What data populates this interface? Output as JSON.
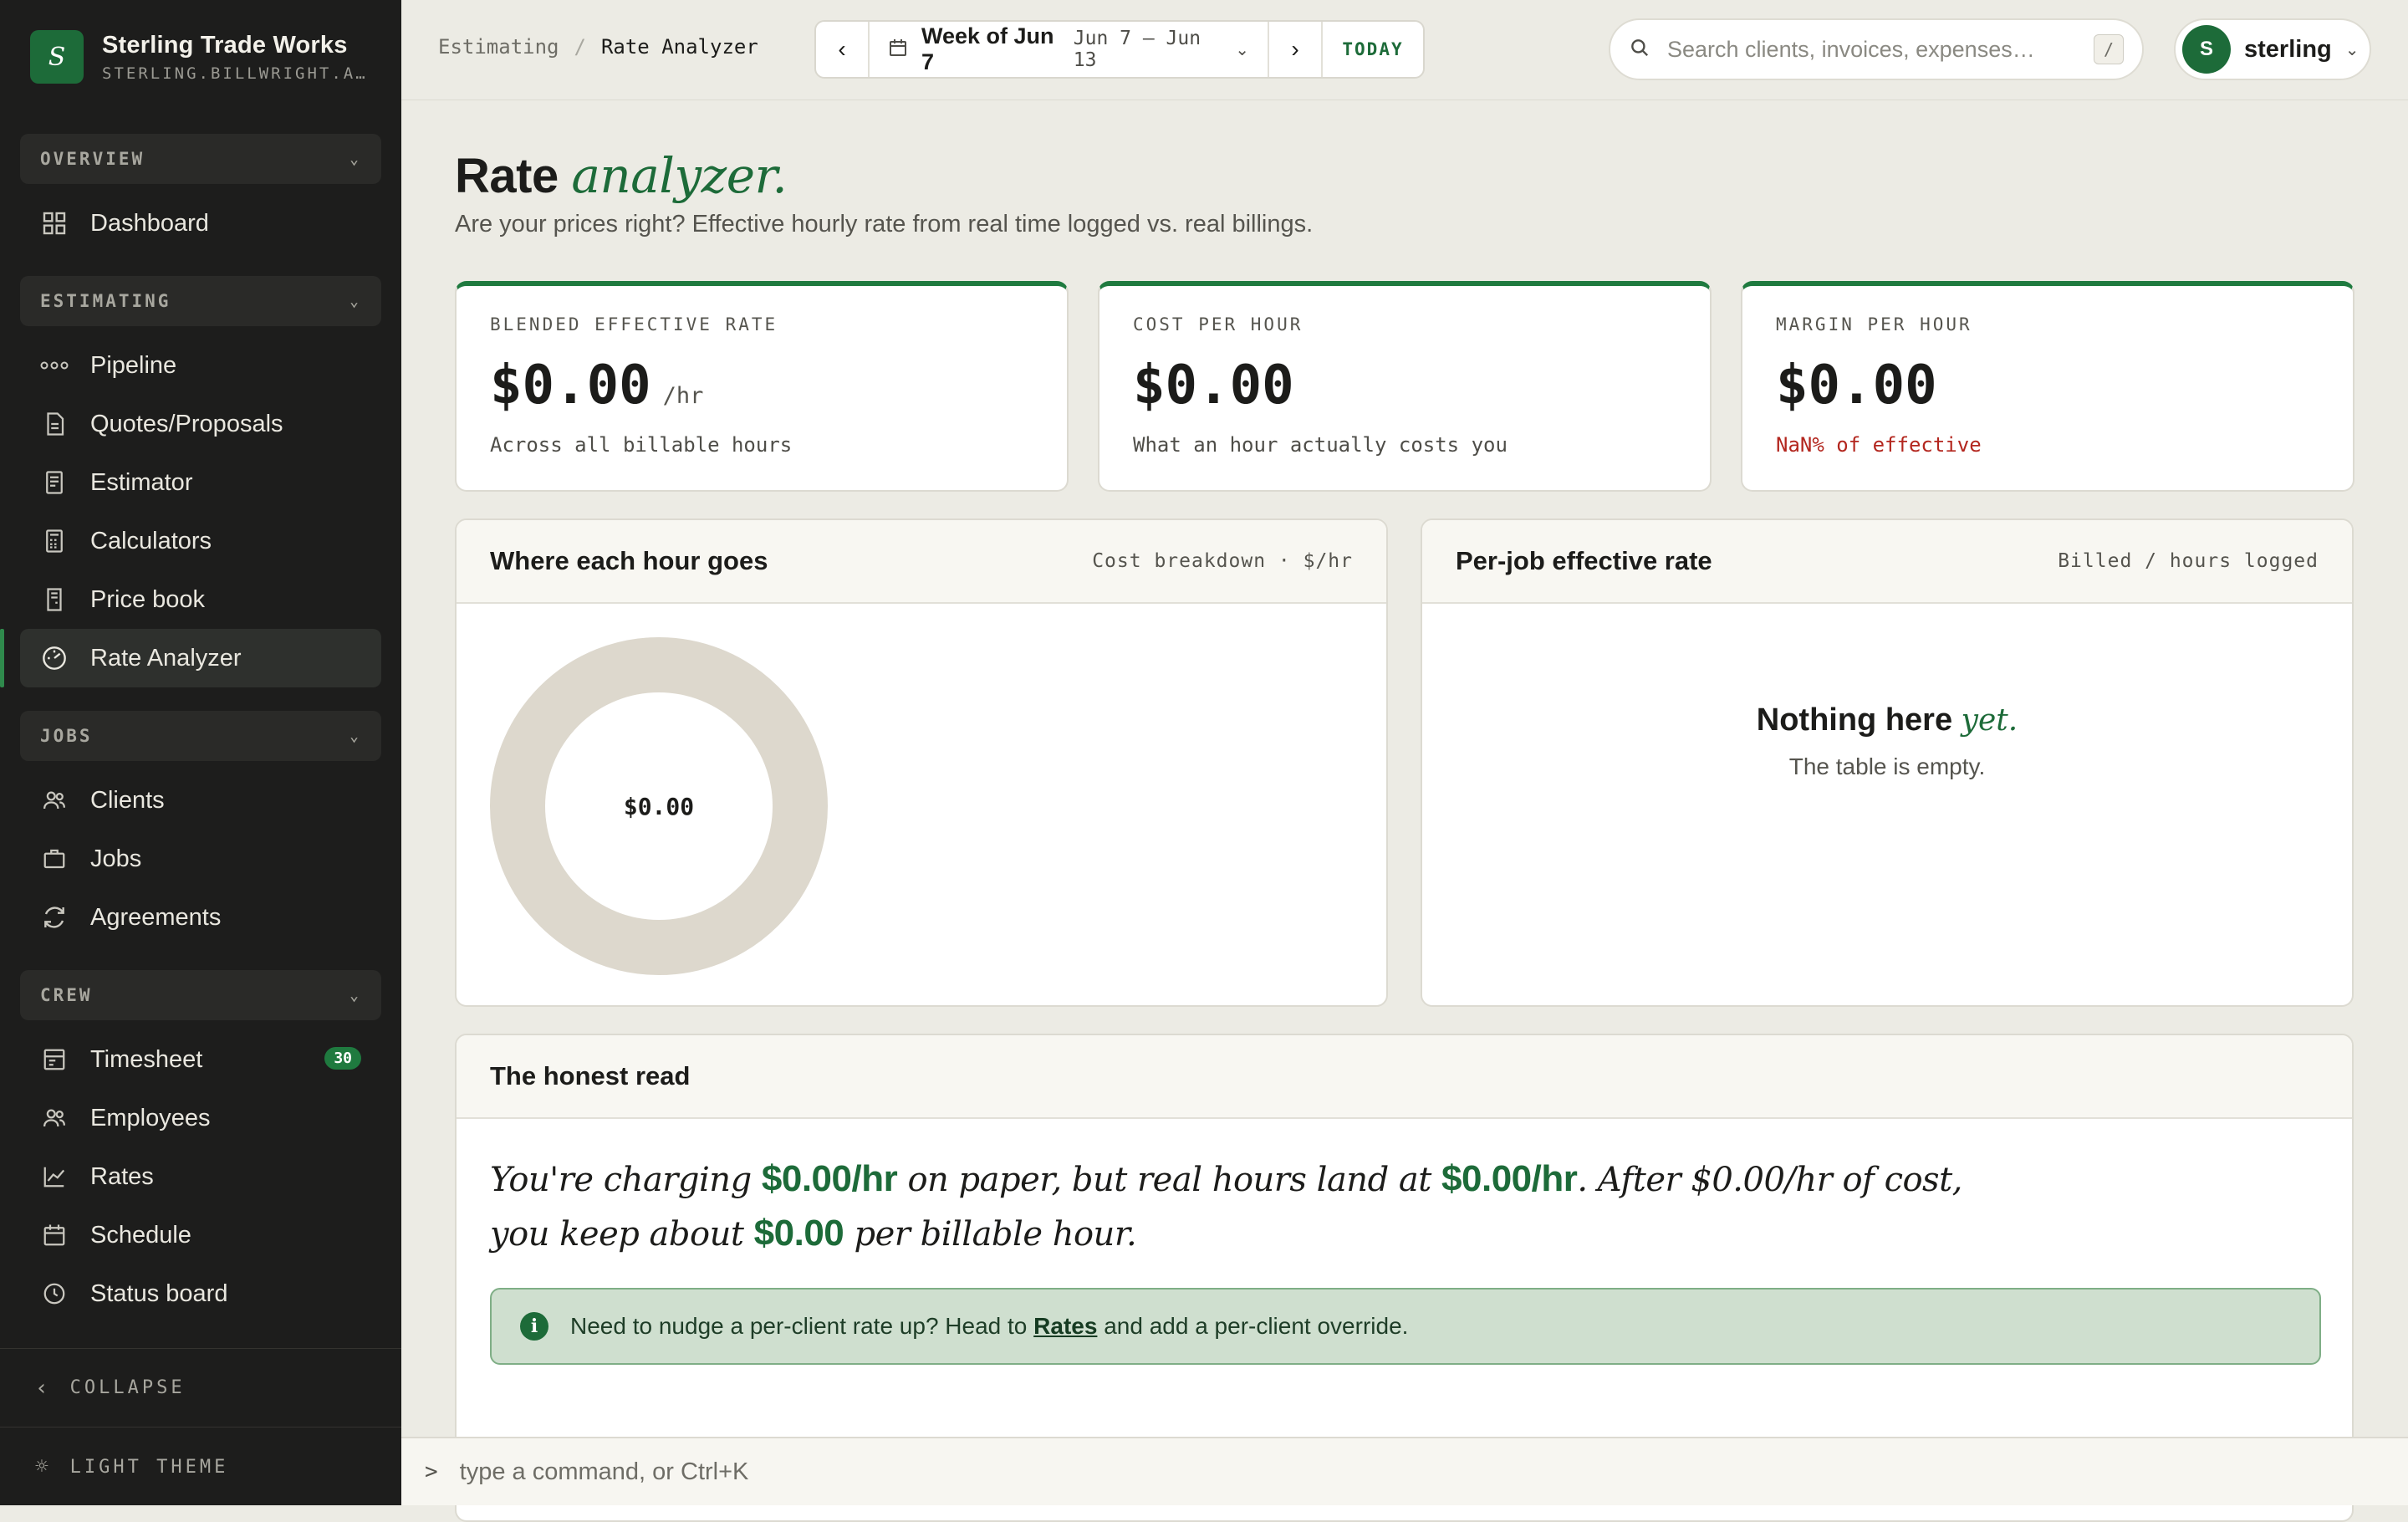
{
  "brand": {
    "name": "Sterling Trade Works",
    "domain": "STERLING.BILLWRIGHT.A…",
    "logo_letter": "S"
  },
  "sidebar": {
    "sections": [
      {
        "label": "OVERVIEW",
        "items": [
          {
            "label": "Dashboard",
            "icon": "grid-icon"
          }
        ]
      },
      {
        "label": "ESTIMATING",
        "items": [
          {
            "label": "Pipeline",
            "icon": "pipeline-icon"
          },
          {
            "label": "Quotes/Proposals",
            "icon": "document-icon"
          },
          {
            "label": "Estimator",
            "icon": "receipt-icon"
          },
          {
            "label": "Calculators",
            "icon": "calculator-icon"
          },
          {
            "label": "Price book",
            "icon": "book-icon"
          },
          {
            "label": "Rate Analyzer",
            "icon": "gauge-icon",
            "active": true
          }
        ]
      },
      {
        "label": "JOBS",
        "items": [
          {
            "label": "Clients",
            "icon": "users-icon"
          },
          {
            "label": "Jobs",
            "icon": "briefcase-icon"
          },
          {
            "label": "Agreements",
            "icon": "refresh-icon"
          }
        ]
      },
      {
        "label": "CREW",
        "items": [
          {
            "label": "Timesheet",
            "icon": "timesheet-icon",
            "badge": "30"
          },
          {
            "label": "Employees",
            "icon": "users-icon"
          },
          {
            "label": "Rates",
            "icon": "line-chart-icon"
          },
          {
            "label": "Schedule",
            "icon": "calendar-icon"
          },
          {
            "label": "Status board",
            "icon": "clock-icon"
          }
        ]
      }
    ],
    "collapse_label": "COLLAPSE",
    "theme_label": "LIGHT THEME"
  },
  "topbar": {
    "breadcrumb": {
      "parent": "Estimating",
      "separator": "/",
      "current": "Rate Analyzer"
    },
    "week": {
      "label": "Week of Jun 7",
      "dates": "Jun 7 – Jun 13",
      "today": "TODAY"
    },
    "search": {
      "placeholder": "Search clients, invoices, expenses…",
      "shortcut": "/"
    },
    "user": {
      "initial": "S",
      "name": "sterling"
    }
  },
  "page": {
    "title": "Rate",
    "title_accent": "analyzer.",
    "subtitle": "Are your prices right? Effective hourly rate from real time logged vs. real billings."
  },
  "stats": [
    {
      "label": "BLENDED EFFECTIVE RATE",
      "value": "$0.00",
      "unit": "/hr",
      "note": "Across all billable hours",
      "note_status": "normal"
    },
    {
      "label": "COST PER HOUR",
      "value": "$0.00",
      "unit": "",
      "note": "What an hour actually costs you",
      "note_status": "normal"
    },
    {
      "label": "MARGIN PER HOUR",
      "value": "$0.00",
      "unit": "",
      "note": "NaN% of effective",
      "note_status": "bad"
    }
  ],
  "breakdown": {
    "title": "Where each hour goes",
    "meta": "Cost breakdown · $/hr",
    "center_value": "$0.00"
  },
  "per_job": {
    "title": "Per-job effective rate",
    "meta": "Billed / hours logged",
    "empty_title": "Nothing here",
    "empty_accent": "yet.",
    "empty_sub": "The table is empty."
  },
  "honest": {
    "title": "The honest read",
    "p1": "You're charging ",
    "charge": "$0.00/hr",
    "p2": " on paper, but real hours land at ",
    "real": "$0.00/hr",
    "p3": ". After $0.00/hr of cost,",
    "p4": "you keep about ",
    "keep": "$0.00",
    "p5": " per billable hour.",
    "notice_pre": "Need to nudge a per-client rate up? Head to ",
    "notice_link": "Rates",
    "notice_post": " and add a per-client override."
  },
  "command": {
    "prompt": ">",
    "placeholder": "type a command, or Ctrl+K"
  },
  "colors": {
    "accent": "#1d6b39",
    "sidebar": "#1d1d1c",
    "background": "#ecebe4",
    "danger": "#b3261e",
    "donut_track": "#ddd8cd"
  }
}
